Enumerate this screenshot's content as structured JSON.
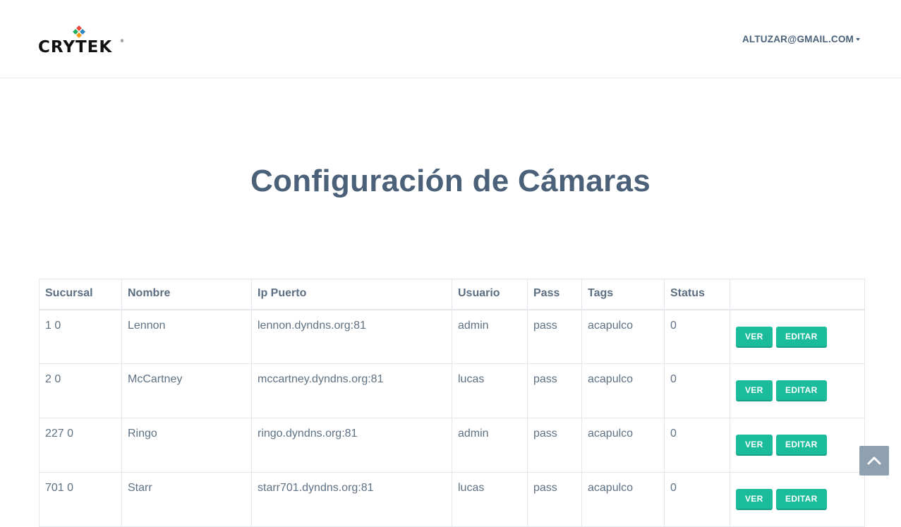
{
  "brand": {
    "logo_text": "CRYTEK"
  },
  "user_menu": {
    "email": "ALTUZAR@GMAIL.COM"
  },
  "page": {
    "title": "Configuración de Cámaras"
  },
  "table": {
    "headers": [
      "Sucursal",
      "Nombre",
      "Ip Puerto",
      "Usuario",
      "Pass",
      "Tags",
      "Status",
      ""
    ],
    "rows": [
      {
        "sucursal": "1 0",
        "nombre": "Lennon",
        "ip_puerto": "lennon.dyndns.org:81",
        "usuario": "admin",
        "pass": "pass",
        "tags": "acapulco",
        "status": "0"
      },
      {
        "sucursal": "2 0",
        "nombre": "McCartney",
        "ip_puerto": "mccartney.dyndns.org:81",
        "usuario": "lucas",
        "pass": "pass",
        "tags": "acapulco",
        "status": "0"
      },
      {
        "sucursal": "227 0",
        "nombre": "Ringo",
        "ip_puerto": "ringo.dyndns.org:81",
        "usuario": "admin",
        "pass": "pass",
        "tags": "acapulco",
        "status": "0"
      },
      {
        "sucursal": "701 0",
        "nombre": "Starr",
        "ip_puerto": "starr701.dyndns.org:81",
        "usuario": "lucas",
        "pass": "pass",
        "tags": "acapulco",
        "status": "0"
      }
    ],
    "view_label": "VER",
    "edit_label": "EDITAR"
  },
  "colors": {
    "accent": "#1abc9c",
    "heading": "#4a6179",
    "scroll_button": "#8fa0b0"
  },
  "icons": {
    "scroll_top": "chevron-up-icon",
    "user_caret": "caret-down-icon"
  }
}
